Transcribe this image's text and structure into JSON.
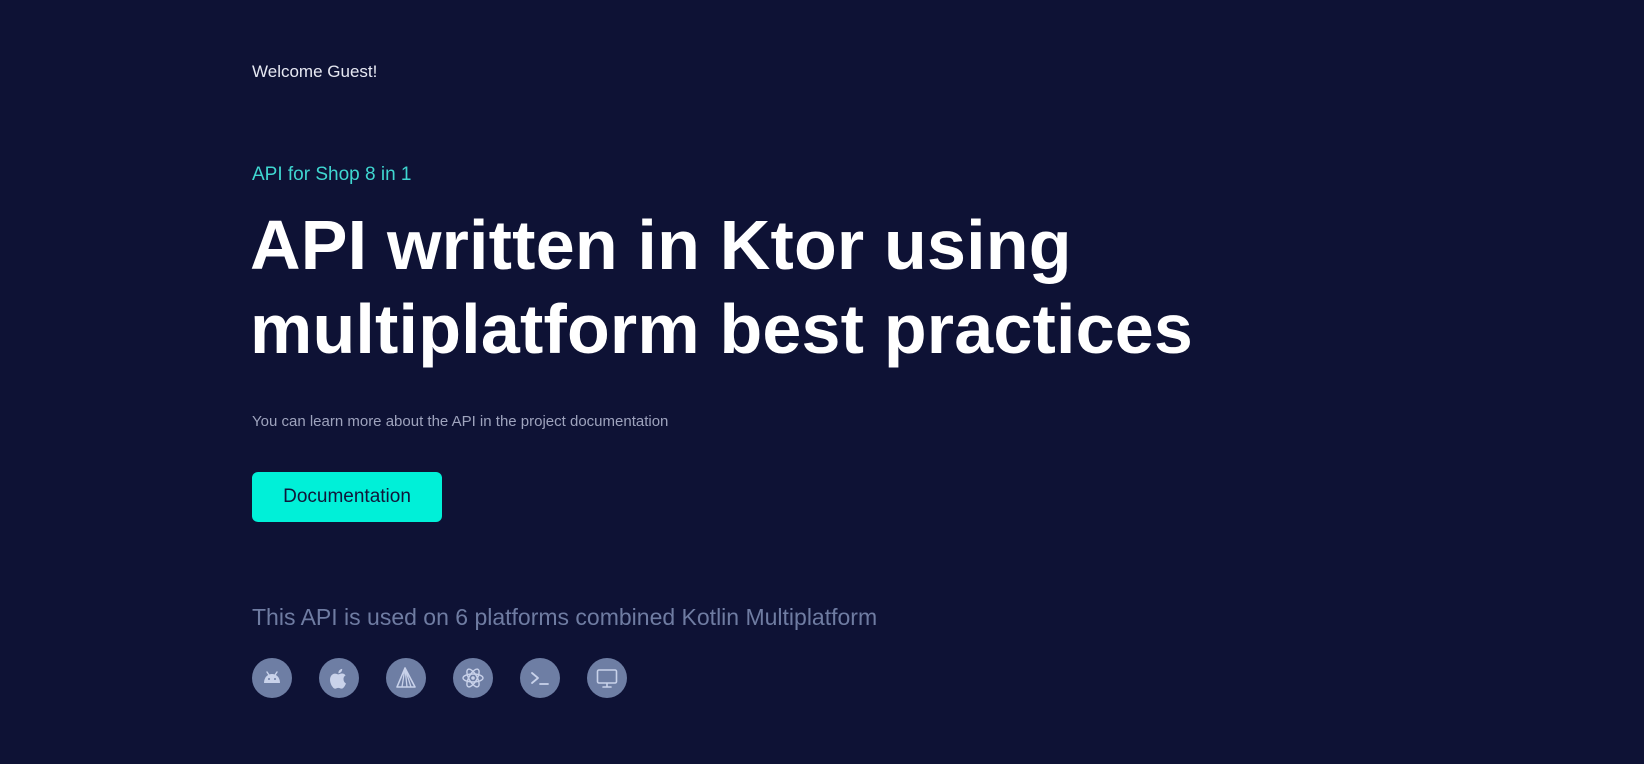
{
  "header": {
    "welcome": "Welcome Guest!"
  },
  "hero": {
    "eyebrow": "API for Shop 8 in 1",
    "headline": "API written in Ktor using multiplatform best practices",
    "description": "You can learn more about the API in the project documentation",
    "doc_button": "Documentation"
  },
  "platforms": {
    "text": "This API is used on 6 platforms combined Kotlin Multiplatform",
    "icons": [
      "android-icon",
      "apple-icon",
      "aurora-icon",
      "react-atom-icon",
      "terminal-icon",
      "desktop-icon"
    ]
  },
  "colors": {
    "background": "#0e1235",
    "accent": "#00f0d8",
    "eyebrow": "#3fd6d0",
    "icon_bg": "#6e7ea4",
    "icon_fg": "#c9d2ea"
  }
}
